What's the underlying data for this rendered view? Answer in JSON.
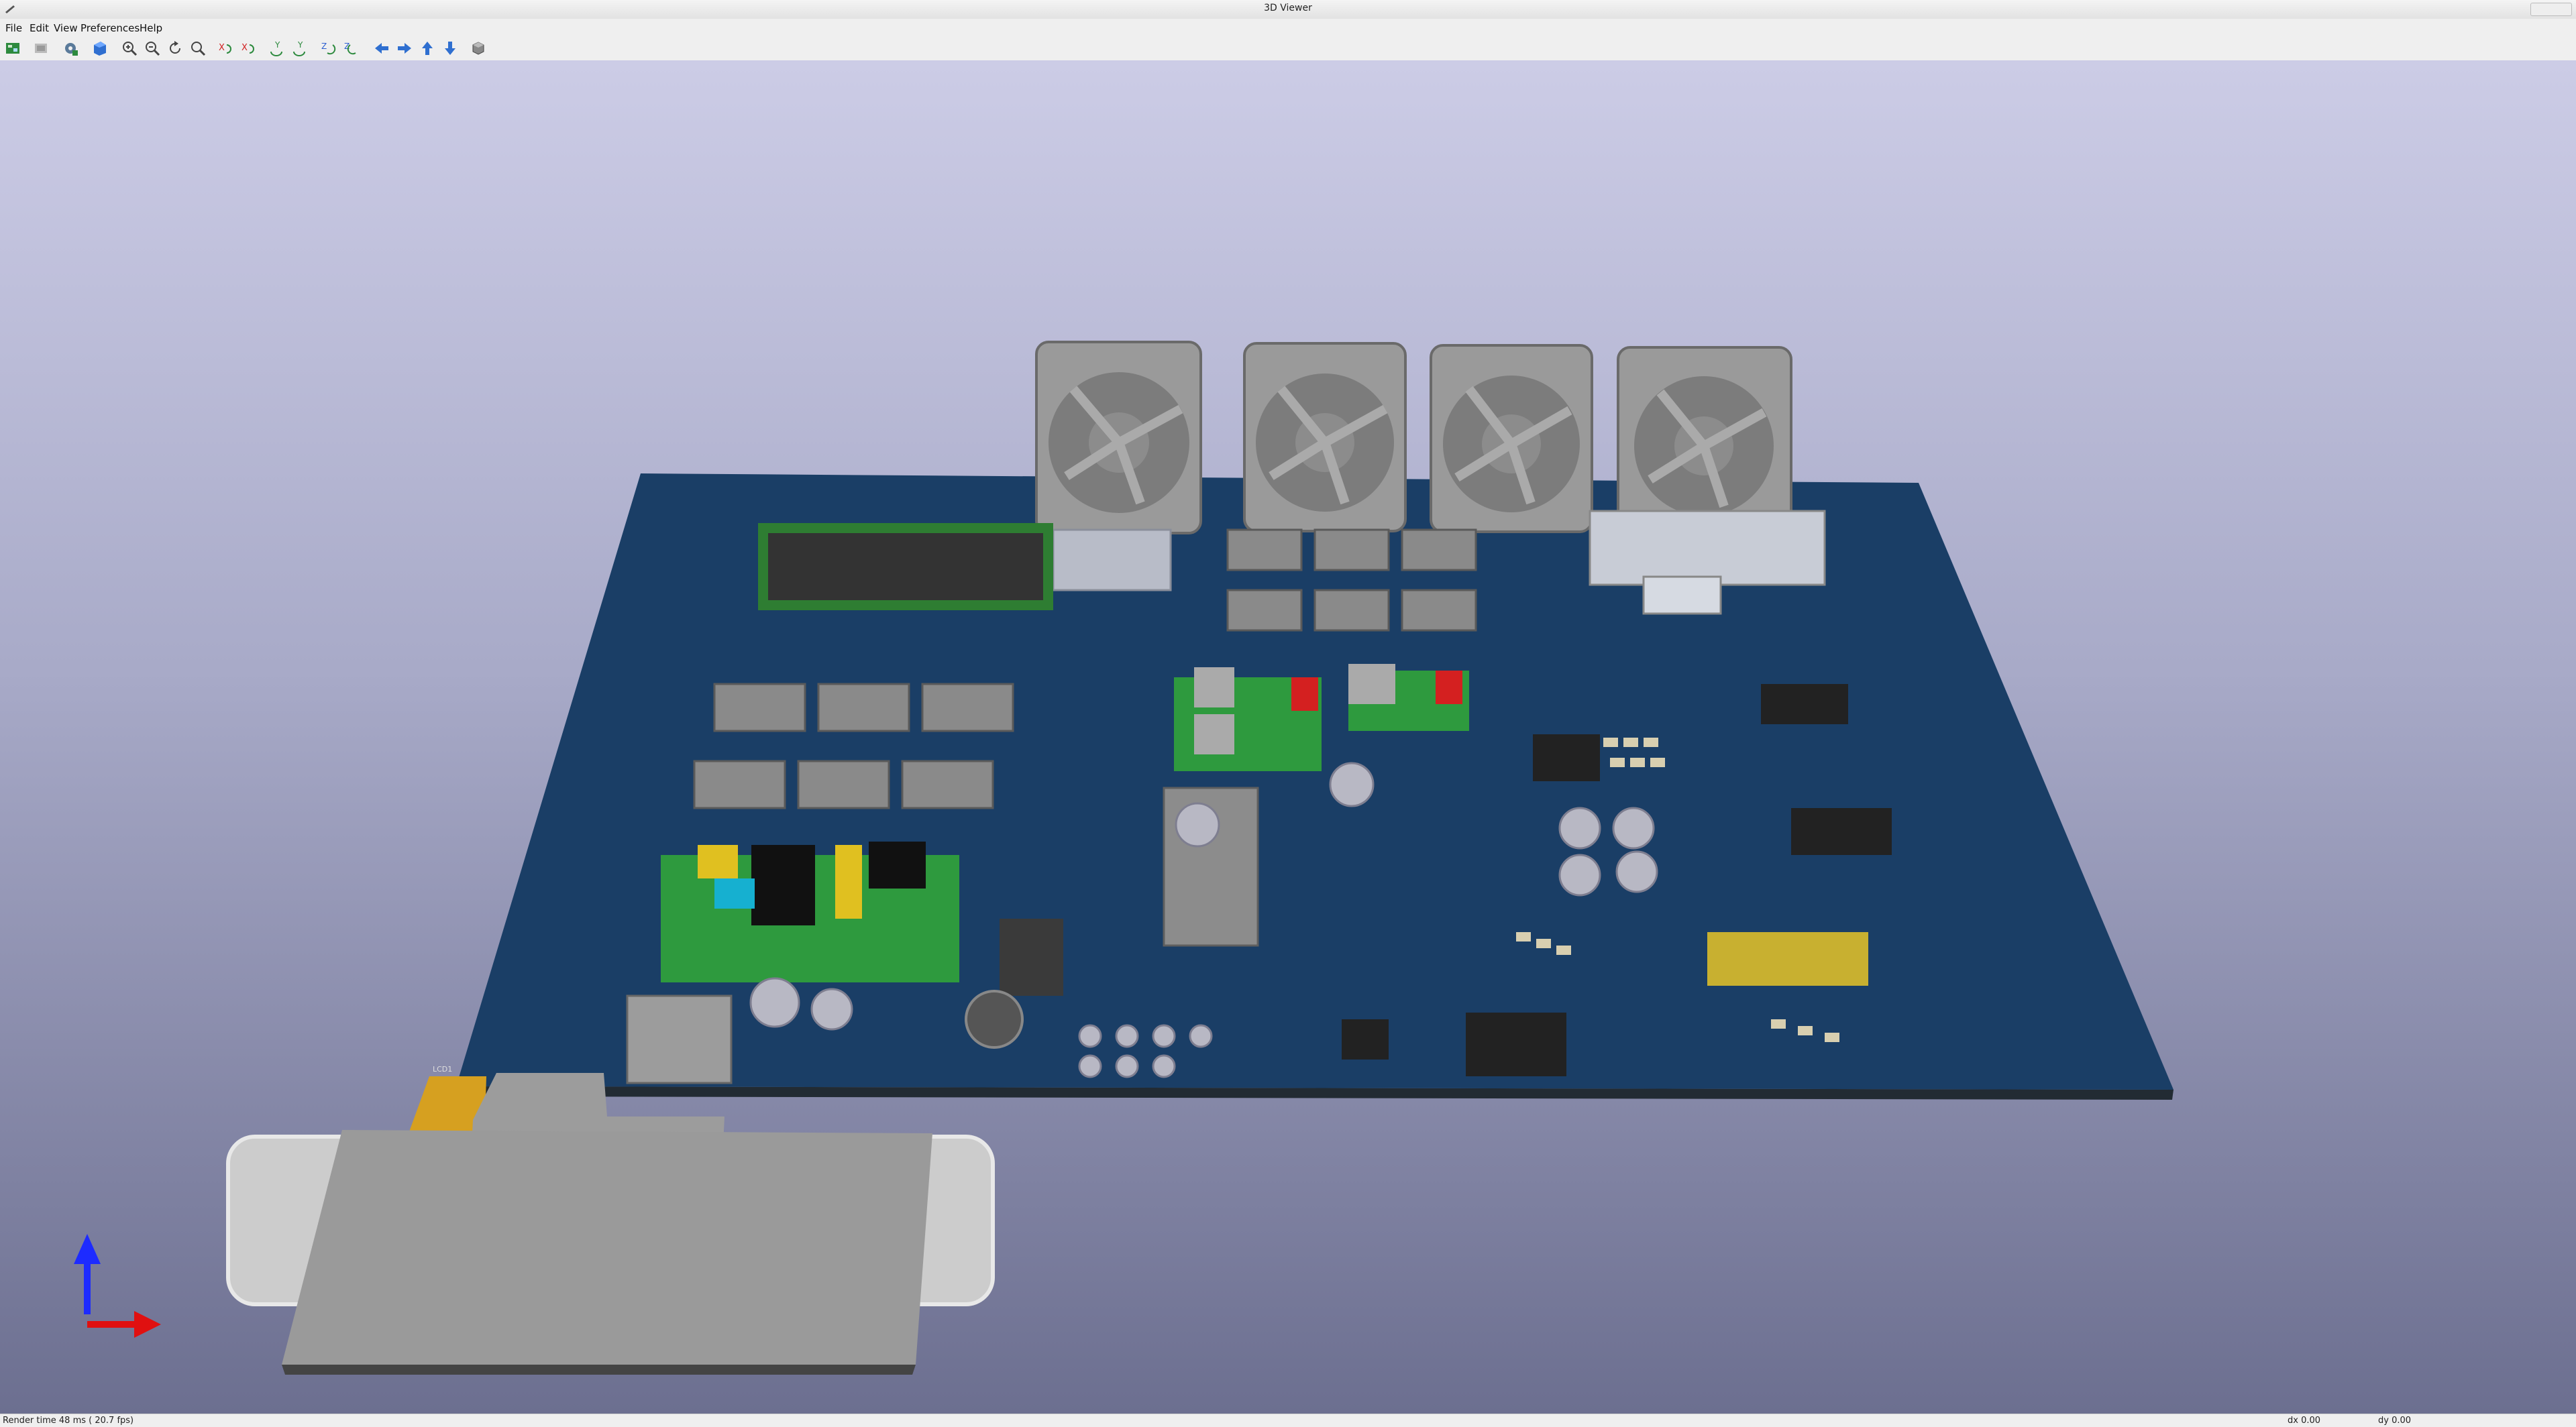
{
  "window": {
    "title": "3D Viewer"
  },
  "menu": {
    "file": "File",
    "edit": "Edit",
    "view": "View",
    "preferences": "Preferences",
    "help": "Help"
  },
  "toolbar_icons": [
    "render-toggle-icon",
    "copy-image-icon",
    "settings-gear-icon",
    "realtime-render-icon",
    "zoom-in-icon",
    "zoom-out-icon",
    "redraw-icon",
    "zoom-fit-icon",
    "rotate-x-cw-icon",
    "rotate-x-ccw-icon",
    "rotate-y-cw-icon",
    "rotate-y-ccw-icon",
    "rotate-z-cw-icon",
    "rotate-z-ccw-icon",
    "pan-left-icon",
    "pan-right-icon",
    "pan-up-icon",
    "pan-down-icon",
    "ortho-toggle-icon"
  ],
  "labels": {
    "lcd": "LCD1"
  },
  "status": {
    "render": "Render time 48 ms ( 20.7 fps)",
    "dx": "dx 0.00",
    "dy": "dy 0.00"
  },
  "colors": {
    "board": "#1a3e66",
    "board_edge": "#222b33",
    "fan": "#9a9a9a",
    "axis_z": "#1d2bff",
    "axis_x": "#e01010"
  }
}
